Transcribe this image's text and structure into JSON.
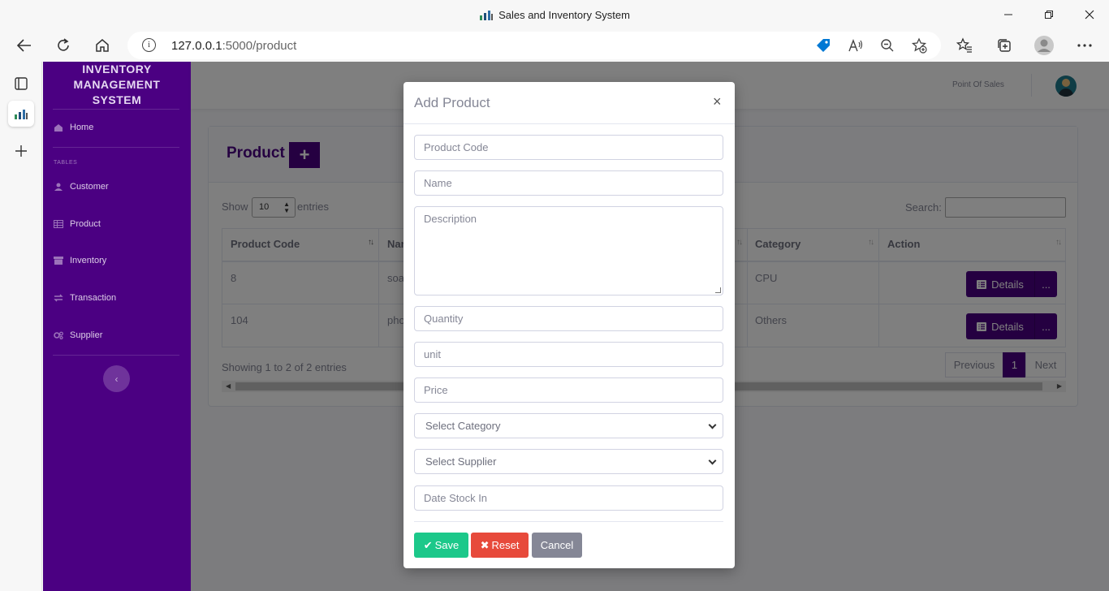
{
  "window": {
    "title": "Sales and Inventory System"
  },
  "browser": {
    "url_host": "127.0.0.1",
    "url_rest": ":5000/product"
  },
  "sidebar": {
    "brand": [
      "INVENTORY",
      "MANAGEMENT",
      "SYSTEM"
    ],
    "home": "Home",
    "section_heading": "TABLES",
    "items": [
      "Customer",
      "Product",
      "Inventory",
      "Transaction",
      "Supplier"
    ],
    "toggle_glyph": "‹"
  },
  "topbar": {
    "point_of_sales": "Point Of Sales"
  },
  "page": {
    "title": "Product",
    "add_glyph": "+",
    "show_label": "Show",
    "entries_select_value": "10",
    "entries_label": "entries",
    "search_label": "Search:",
    "table": {
      "columns": [
        "Product Code",
        "Nar",
        "Category",
        "Action"
      ],
      "rows": [
        {
          "code": "8",
          "name": "soa",
          "category": "CPU"
        },
        {
          "code": "104",
          "name": "pho",
          "category": "Others"
        }
      ],
      "details_label": "Details",
      "more_label": "..."
    },
    "showing": "Showing 1 to 2 of 2 entries",
    "pagination": {
      "previous": "Previous",
      "current": "1",
      "next": "Next"
    }
  },
  "modal": {
    "title": "Add Product",
    "close_glyph": "×",
    "placeholders": {
      "product_code": "Product Code",
      "name": "Name",
      "description": "Description",
      "quantity": "Quantity",
      "unit": "unit",
      "price": "Price",
      "date_stock_in": "Date Stock In"
    },
    "selects": {
      "category": "Select Category",
      "supplier": "Select Supplier"
    },
    "buttons": {
      "save": "Save",
      "reset": "Reset",
      "cancel": "Cancel"
    }
  },
  "colors": {
    "sidebar": "#4b0082",
    "save": "#1cc88a",
    "reset": "#e74a3b",
    "cancel": "#858796",
    "link_blue": "#0078d4"
  }
}
